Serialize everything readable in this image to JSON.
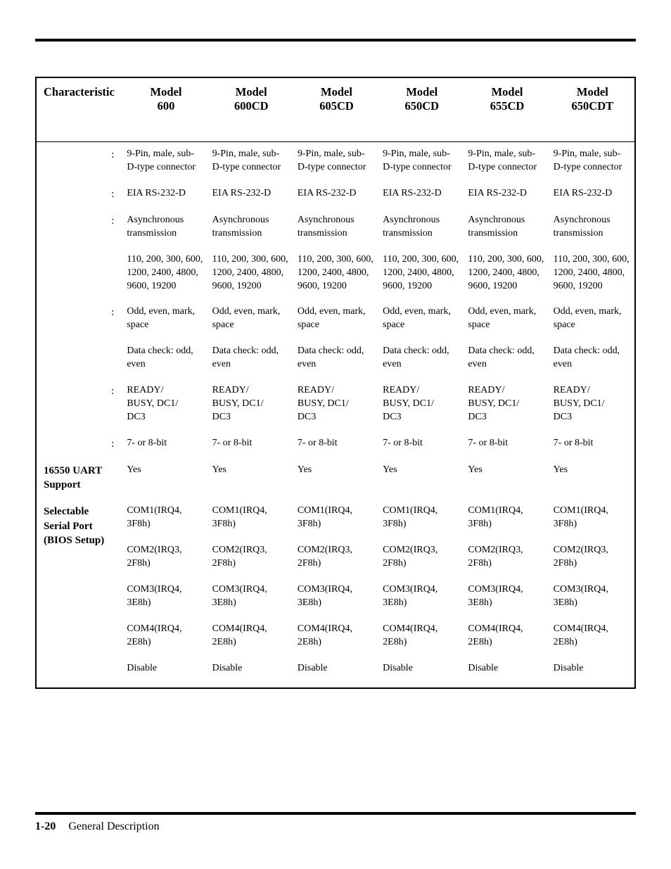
{
  "columns": {
    "c0": "Characteristic",
    "c1_a": "Model",
    "c1_b": "600",
    "c2_a": "Model",
    "c2_b": "600CD",
    "c3_a": "Model",
    "c3_b": "605CD",
    "c4_a": "Model",
    "c4_b": "650CD",
    "c5_a": "Model",
    "c5_b": "655CD",
    "c6_a": "Model",
    "c6_b": "650CDT"
  },
  "labels": {
    "r0": ":",
    "r1": ":",
    "r2": ":",
    "r3": "",
    "r4": ":",
    "r5": "",
    "r6": ":",
    "r7": ":",
    "r8": "16550 UART Support",
    "r9": "Selectable Serial Port (BIOS Setup)"
  },
  "cells": {
    "r0": {
      "v1": "9-Pin, male, sub-D-type connector",
      "v2": "9-Pin, male, sub-D-type connector",
      "v3": "9-Pin, male, sub-D-type connector",
      "v4": "9-Pin, male, sub-D-type connector",
      "v5": "9-Pin, male, sub-D-type connector",
      "v6": "9-Pin, male, sub-D-type connector"
    },
    "r1": {
      "v1": "EIA RS-232-D",
      "v2": "EIA RS-232-D",
      "v3": "EIA RS-232-D",
      "v4": "EIA RS-232-D",
      "v5": "EIA RS-232-D",
      "v6": "EIA RS-232-D"
    },
    "r2": {
      "v1": "Asynchronous transmission",
      "v2": "Asynchronous transmission",
      "v3": "Asynchronous transmission",
      "v4": "Asynchronous transmission",
      "v5": "Asynchronous transmission",
      "v6": "Asynchronous transmission"
    },
    "r3": {
      "v1": "110, 200, 300, 600, 1200, 2400, 4800, 9600, 19200",
      "v2": "110, 200, 300, 600, 1200, 2400, 4800, 9600, 19200",
      "v3": "110, 200, 300, 600, 1200, 2400, 4800, 9600, 19200",
      "v4": "110, 200, 300, 600, 1200, 2400, 4800, 9600, 19200",
      "v5": "110, 200, 300, 600, 1200, 2400, 4800, 9600, 19200",
      "v6": "110, 200, 300, 600, 1200, 2400, 4800, 9600, 19200"
    },
    "r4": {
      "v1": "Odd, even, mark, space",
      "v2": "Odd, even, mark, space",
      "v3": "Odd, even, mark, space",
      "v4": "Odd, even, mark, space",
      "v5": "Odd, even, mark, space",
      "v6": "Odd, even, mark, space"
    },
    "r5": {
      "v1": "Data check: odd, even",
      "v2": "Data check: odd, even",
      "v3": "Data check: odd, even",
      "v4": "Data check: odd, even",
      "v5": "Data check: odd, even",
      "v6": "Data check: odd, even"
    },
    "r6": {
      "v1": "READY/\nBUSY, DC1/\nDC3",
      "v2": "READY/\nBUSY, DC1/\nDC3",
      "v3": "READY/\nBUSY, DC1/\nDC3",
      "v4": "READY/\nBUSY, DC1/\nDC3",
      "v5": "READY/\nBUSY, DC1/\nDC3",
      "v6": "READY/\nBUSY, DC1/\nDC3"
    },
    "r7": {
      "v1": "7- or 8-bit",
      "v2": "7- or 8-bit",
      "v3": "7- or 8-bit",
      "v4": "7- or 8-bit",
      "v5": "7- or 8-bit",
      "v6": "7- or 8-bit"
    },
    "r8": {
      "v1": "Yes",
      "v2": "Yes",
      "v3": "Yes",
      "v4": "Yes",
      "v5": "Yes",
      "v6": "Yes"
    },
    "r9a": {
      "v1": "COM1(IRQ4, 3F8h)",
      "v2": "COM1(IRQ4, 3F8h)",
      "v3": "COM1(IRQ4, 3F8h)",
      "v4": "COM1(IRQ4, 3F8h)",
      "v5": "COM1(IRQ4, 3F8h)",
      "v6": "COM1(IRQ4, 3F8h)"
    },
    "r9b": {
      "v1": "COM2(IRQ3, 2F8h)",
      "v2": "COM2(IRQ3, 2F8h)",
      "v3": "COM2(IRQ3, 2F8h)",
      "v4": "COM2(IRQ3, 2F8h)",
      "v5": "COM2(IRQ3, 2F8h)",
      "v6": "COM2(IRQ3, 2F8h)"
    },
    "r9c": {
      "v1": "COM3(IRQ4, 3E8h)",
      "v2": "COM3(IRQ4, 3E8h)",
      "v3": "COM3(IRQ4, 3E8h)",
      "v4": "COM3(IRQ4, 3E8h)",
      "v5": "COM3(IRQ4, 3E8h)",
      "v6": "COM3(IRQ4, 3E8h)"
    },
    "r9d": {
      "v1": "COM4(IRQ4, 2E8h)",
      "v2": "COM4(IRQ4, 2E8h)",
      "v3": "COM4(IRQ4, 2E8h)",
      "v4": "COM4(IRQ4, 2E8h)",
      "v5": "COM4(IRQ4, 2E8h)",
      "v6": "COM4(IRQ4, 2E8h)"
    },
    "r9e": {
      "v1": "Disable",
      "v2": "Disable",
      "v3": "Disable",
      "v4": "Disable",
      "v5": "Disable",
      "v6": "Disable"
    }
  },
  "footer": {
    "page": "1-20",
    "section": "General Description"
  }
}
